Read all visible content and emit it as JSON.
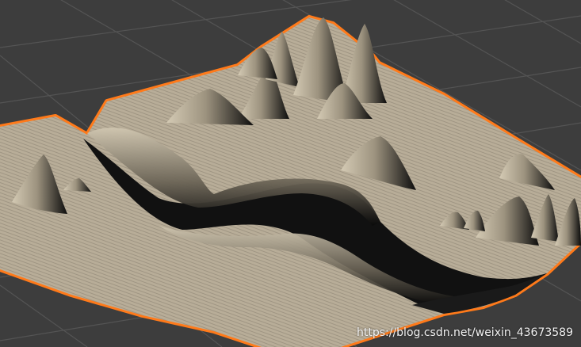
{
  "viewport": {
    "type": "3d-editor-viewport",
    "background_color": "#3d3d3d",
    "grid_color": "#545454",
    "selection_outline_color": "#ff7a1a",
    "terrain_color": "#b8ad98",
    "shadow_color": "#0a0a0a",
    "object": {
      "name": "terrain-mesh",
      "selected": true
    }
  },
  "watermark": {
    "text": "https://blog.csdn.net/weixin_43673589"
  }
}
